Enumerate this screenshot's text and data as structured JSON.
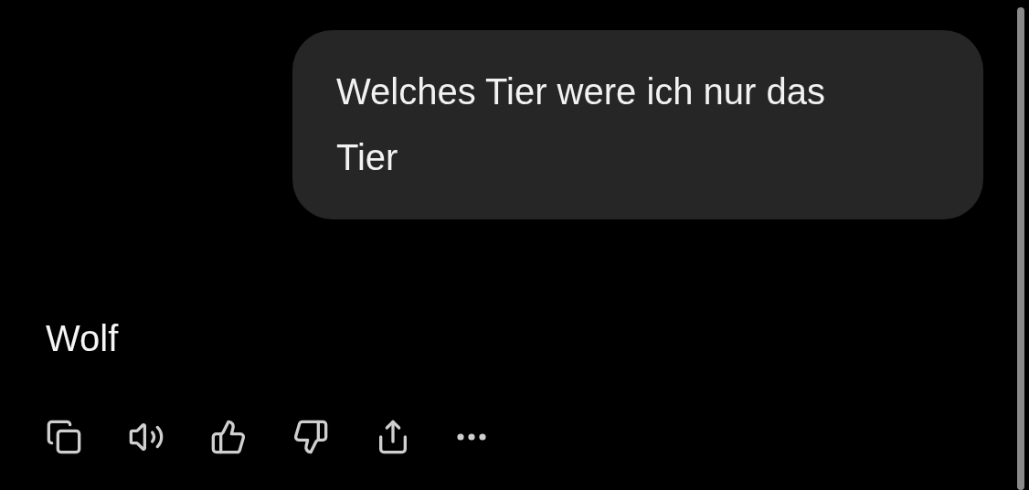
{
  "conversation": {
    "user_message": "Welches Tier were ich nur das Tier",
    "assistant_reply": "Wolf",
    "actions": [
      {
        "kind": "copy"
      },
      {
        "kind": "read-aloud"
      },
      {
        "kind": "like"
      },
      {
        "kind": "dislike"
      },
      {
        "kind": "share"
      },
      {
        "kind": "more"
      }
    ]
  }
}
